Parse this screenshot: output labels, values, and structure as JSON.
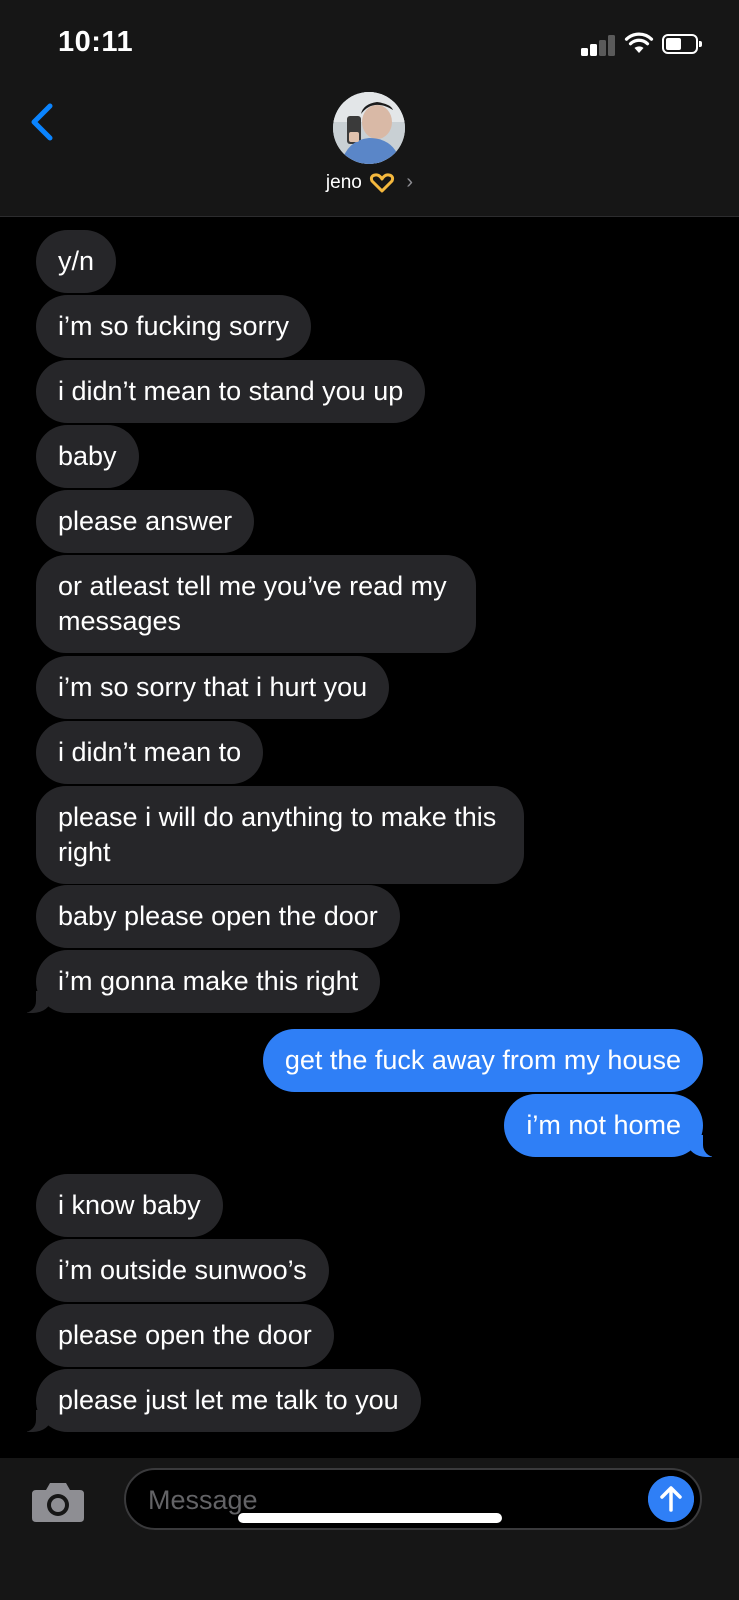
{
  "status_bar": {
    "time": "10:11"
  },
  "header": {
    "contact_name": "jeno",
    "contact_emoji": "heart-hands-icon"
  },
  "messages": [
    {
      "from": "contact",
      "text": "y/n"
    },
    {
      "from": "contact",
      "text": "i’m so fucking sorry"
    },
    {
      "from": "contact",
      "text": "i didn’t mean to stand you up"
    },
    {
      "from": "contact",
      "text": "baby"
    },
    {
      "from": "contact",
      "text": "please answer"
    },
    {
      "from": "contact",
      "text": "or atleast tell me you’ve read my messages"
    },
    {
      "from": "contact",
      "text": "i’m so sorry that i hurt you"
    },
    {
      "from": "contact",
      "text": "i didn’t mean to"
    },
    {
      "from": "contact",
      "text": "please i will do anything to make this right"
    },
    {
      "from": "contact",
      "text": "baby please open the door"
    },
    {
      "from": "contact",
      "text": "i’m gonna make this right"
    },
    {
      "from": "me",
      "text": "get the fuck away from my house"
    },
    {
      "from": "me",
      "text": "i’m not home"
    },
    {
      "from": "contact",
      "text": "i know baby"
    },
    {
      "from": "contact",
      "text": "i’m outside sunwoo’s"
    },
    {
      "from": "contact",
      "text": "please open the door"
    },
    {
      "from": "contact",
      "text": "please just let me talk to you"
    }
  ],
  "composer": {
    "placeholder": "Message"
  },
  "colors": {
    "sent_bubble": "#2f7ff6",
    "received_bubble": "#262629",
    "accent": "#0a84ff"
  }
}
